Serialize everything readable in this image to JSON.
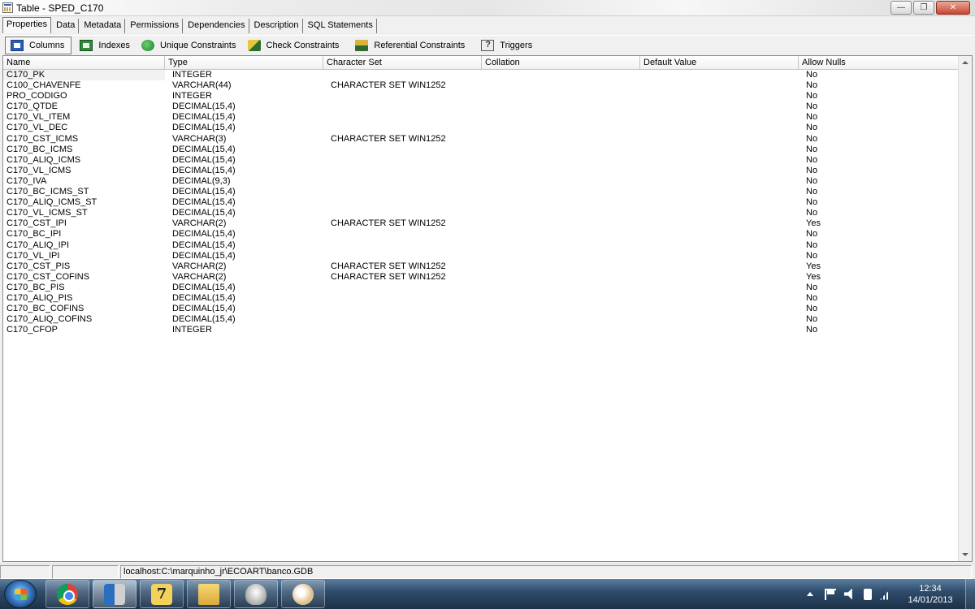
{
  "window": {
    "title": "Table - SPED_C170",
    "controls": {
      "minimize": "minimize",
      "maximize": "restore",
      "close": "close"
    }
  },
  "main_tabs": [
    {
      "label": "Properties",
      "active": true
    },
    {
      "label": "Data",
      "active": false
    },
    {
      "label": "Metadata",
      "active": false
    },
    {
      "label": "Permissions",
      "active": false
    },
    {
      "label": "Dependencies",
      "active": false
    },
    {
      "label": "Description",
      "active": false
    },
    {
      "label": "SQL Statements",
      "active": false
    }
  ],
  "sub_tabs": [
    {
      "label": "Columns",
      "icon": "columns-icon",
      "active": true
    },
    {
      "label": "Indexes",
      "icon": "indexes-icon",
      "active": false
    },
    {
      "label": "Unique Constraints",
      "icon": "unique-constraints-icon",
      "active": false
    },
    {
      "label": "Check Constraints",
      "icon": "check-constraints-icon",
      "active": false
    },
    {
      "label": "Referential Constraints",
      "icon": "referential-constraints-icon",
      "active": false
    },
    {
      "label": "Triggers",
      "icon": "triggers-icon",
      "active": false
    }
  ],
  "grid": {
    "columns": [
      "Name",
      "Type",
      "Character Set",
      "Collation",
      "Default Value",
      "Allow Nulls"
    ],
    "rows": [
      [
        "C170_PK",
        "INTEGER",
        "",
        "",
        "",
        "No"
      ],
      [
        "C100_CHAVENFE",
        "VARCHAR(44)",
        "CHARACTER SET WIN1252",
        "",
        "",
        "No"
      ],
      [
        "PRO_CODIGO",
        "INTEGER",
        "",
        "",
        "",
        "No"
      ],
      [
        "C170_QTDE",
        "DECIMAL(15,4)",
        "",
        "",
        "",
        "No"
      ],
      [
        "C170_VL_ITEM",
        "DECIMAL(15,4)",
        "",
        "",
        "",
        "No"
      ],
      [
        "C170_VL_DEC",
        "DECIMAL(15,4)",
        "",
        "",
        "",
        "No"
      ],
      [
        "C170_CST_ICMS",
        "VARCHAR(3)",
        "CHARACTER SET WIN1252",
        "",
        "",
        "No"
      ],
      [
        "C170_BC_ICMS",
        "DECIMAL(15,4)",
        "",
        "",
        "",
        "No"
      ],
      [
        "C170_ALIQ_ICMS",
        "DECIMAL(15,4)",
        "",
        "",
        "",
        "No"
      ],
      [
        "C170_VL_ICMS",
        "DECIMAL(15,4)",
        "",
        "",
        "",
        "No"
      ],
      [
        "C170_IVA",
        "DECIMAL(9,3)",
        "",
        "",
        "",
        "No"
      ],
      [
        "C170_BC_ICMS_ST",
        "DECIMAL(15,4)",
        "",
        "",
        "",
        "No"
      ],
      [
        "C170_ALIQ_ICMS_ST",
        "DECIMAL(15,4)",
        "",
        "",
        "",
        "No"
      ],
      [
        "C170_VL_ICMS_ST",
        "DECIMAL(15,4)",
        "",
        "",
        "",
        "No"
      ],
      [
        "C170_CST_IPI",
        "VARCHAR(2)",
        "CHARACTER SET WIN1252",
        "",
        "",
        "Yes"
      ],
      [
        "C170_BC_IPI",
        "DECIMAL(15,4)",
        "",
        "",
        "",
        "No"
      ],
      [
        "C170_ALIQ_IPI",
        "DECIMAL(15,4)",
        "",
        "",
        "",
        "No"
      ],
      [
        "C170_VL_IPI",
        "DECIMAL(15,4)",
        "",
        "",
        "",
        "No"
      ],
      [
        "C170_CST_PIS",
        "VARCHAR(2)",
        "CHARACTER SET WIN1252",
        "",
        "",
        "Yes"
      ],
      [
        "C170_CST_COFINS",
        "VARCHAR(2)",
        "CHARACTER SET WIN1252",
        "",
        "",
        "Yes"
      ],
      [
        "C170_BC_PIS",
        "DECIMAL(15,4)",
        "",
        "",
        "",
        "No"
      ],
      [
        "C170_ALIQ_PIS",
        "DECIMAL(15,4)",
        "",
        "",
        "",
        "No"
      ],
      [
        "C170_BC_COFINS",
        "DECIMAL(15,4)",
        "",
        "",
        "",
        "No"
      ],
      [
        "C170_ALIQ_COFINS",
        "DECIMAL(15,4)",
        "",
        "",
        "",
        "No"
      ],
      [
        "C170_CFOP",
        "INTEGER",
        "",
        "",
        "",
        "No"
      ]
    ]
  },
  "status_bar": {
    "panel1": "",
    "panel2": "",
    "connection": "localhost:C:\\marquinho_jr\\ECOART\\banco.GDB"
  },
  "taskbar": {
    "apps": [
      {
        "icon": "chrome-icon",
        "active": false
      },
      {
        "icon": "ibexpert-icon",
        "active": true
      },
      {
        "icon": "7zip-icon",
        "active": false
      },
      {
        "icon": "folder-icon",
        "active": false
      },
      {
        "icon": "drive-icon",
        "active": false
      },
      {
        "icon": "paint-icon",
        "active": false
      }
    ],
    "clock": {
      "time": "12:34",
      "date": "14/01/2013"
    }
  }
}
